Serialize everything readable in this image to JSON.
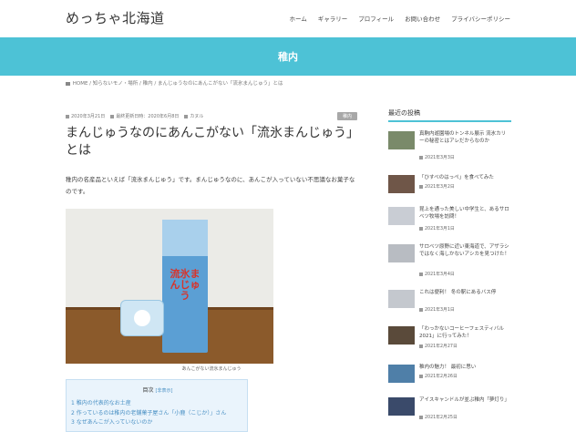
{
  "site": {
    "title": "めっちゃ北海道"
  },
  "nav": [
    "ホーム",
    "ギャラリー",
    "プロフィール",
    "お問い合わせ",
    "プライバシーポリシー"
  ],
  "category_band": {
    "title": "稚内"
  },
  "breadcrumb": "HOME / 知らないモノ・場所 / 稚内 / まんじゅうなのにあんこがない「流氷まんじゅう」とは",
  "post": {
    "published": "2020年3月21日",
    "updated": "最終更新日時：2020年6月8日",
    "author": "カヌル",
    "category": "稚内",
    "title": "まんじゅうなのにあんこがない「流氷まんじゅう」とは",
    "body": "稚内の名産品といえば「流氷まんじゅう」です。まんじゅうなのに、あんこが入っていない不思議なお菓子なのです。",
    "photo_label": "流氷まんじゅう",
    "caption": "あんこがない流氷まんじゅう"
  },
  "toc": {
    "title": "目次",
    "toggle": "[非表示]",
    "items": [
      "1 稚内の代表的なお土産",
      "2 作っているのは稚内の老舗菓子屋さん「小鹿（こじか）」さん",
      "3 なぜあんこが入っていないのか"
    ]
  },
  "sidebar": {
    "heading": "最近の投稿",
    "posts": [
      {
        "title": "真駒内遊園場のトンネル展示 流氷カリーの秘密とはアレだからなのか",
        "date": "2021年3月3日",
        "thumb_color": "#7a8a6a"
      },
      {
        "title": "「ひすべのはっぺ」を食べてみた",
        "date": "2021年3月2日",
        "thumb_color": "#6f5648"
      },
      {
        "title": "昆上を通った美しい中学生と、あるサロベツ牧場を訪問！",
        "date": "2021年3月1日",
        "thumb_color": "#c9cdd4"
      },
      {
        "title": "サロベツ原野に近い東海道で、アザラシではなく海しかないアシカを見つけた！",
        "date": "2021年3月4日",
        "thumb_color": "#b8bcc2"
      },
      {
        "title": "これは便利！ 冬の駅にあるバス停",
        "date": "2021年3月1日",
        "thumb_color": "#c4c8ce"
      },
      {
        "title": "「わっかないコーヒーフェスティバル2021」に行ってみた！",
        "date": "2021年2月27日",
        "thumb_color": "#5a4a3a"
      },
      {
        "title": "稚内の魅力！ 最初に思い",
        "date": "2021年2月26日",
        "thumb_color": "#4f7fa8"
      },
      {
        "title": "アイスキャンドルが並ぶ稚内「夢灯り」",
        "date": "2021年2月25日",
        "thumb_color": "#3a4a6a"
      }
    ]
  }
}
